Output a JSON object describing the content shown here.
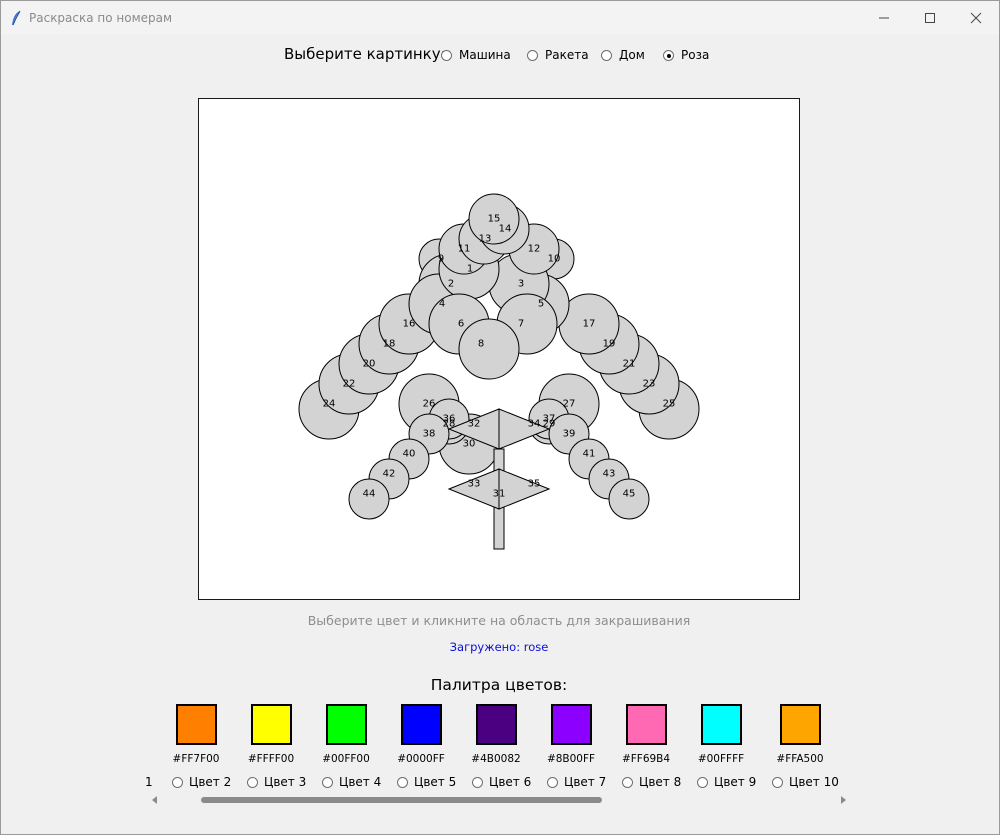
{
  "window": {
    "title": "Раскраска по номерам",
    "icon": "feather-icon"
  },
  "picker": {
    "label": "Выберите картинку:",
    "options": [
      {
        "label": "Машина",
        "selected": false
      },
      {
        "label": "Ракета",
        "selected": false
      },
      {
        "label": "Дом",
        "selected": false
      },
      {
        "label": "Роза",
        "selected": true
      }
    ]
  },
  "canvas": {
    "region_fill": "#d3d3d3",
    "regions": [
      "1",
      "2",
      "3",
      "4",
      "5",
      "6",
      "7",
      "8",
      "9",
      "10",
      "11",
      "12",
      "13",
      "14",
      "15",
      "16",
      "17",
      "18",
      "19",
      "20",
      "21",
      "22",
      "23",
      "24",
      "25",
      "26",
      "27",
      "28",
      "29",
      "30",
      "31",
      "32",
      "33",
      "34",
      "35",
      "36",
      "37",
      "38",
      "39",
      "40",
      "41",
      "42",
      "43",
      "44",
      "45"
    ]
  },
  "hint": "Выберите цвет и кликните на область для закрашивания",
  "status": "Загружено: rose",
  "status_color": "#0b10d8",
  "palette": {
    "title": "Палитра цветов:",
    "colors": [
      {
        "hex": "#FF7F00",
        "label": "Цвет 2"
      },
      {
        "hex": "#FFFF00",
        "label": "Цвет 3"
      },
      {
        "hex": "#00FF00",
        "label": "Цвет 4"
      },
      {
        "hex": "#0000FF",
        "label": "Цвет 5"
      },
      {
        "hex": "#4B0082",
        "label": "Цвет 6"
      },
      {
        "hex": "#8B00FF",
        "label": "Цвет 7"
      },
      {
        "hex": "#FF69B4",
        "label": "Цвет 8"
      },
      {
        "hex": "#00FFFF",
        "label": "Цвет 9"
      },
      {
        "hex": "#FFA500",
        "label": "Цвет 10"
      }
    ],
    "clipped_label": "1"
  }
}
